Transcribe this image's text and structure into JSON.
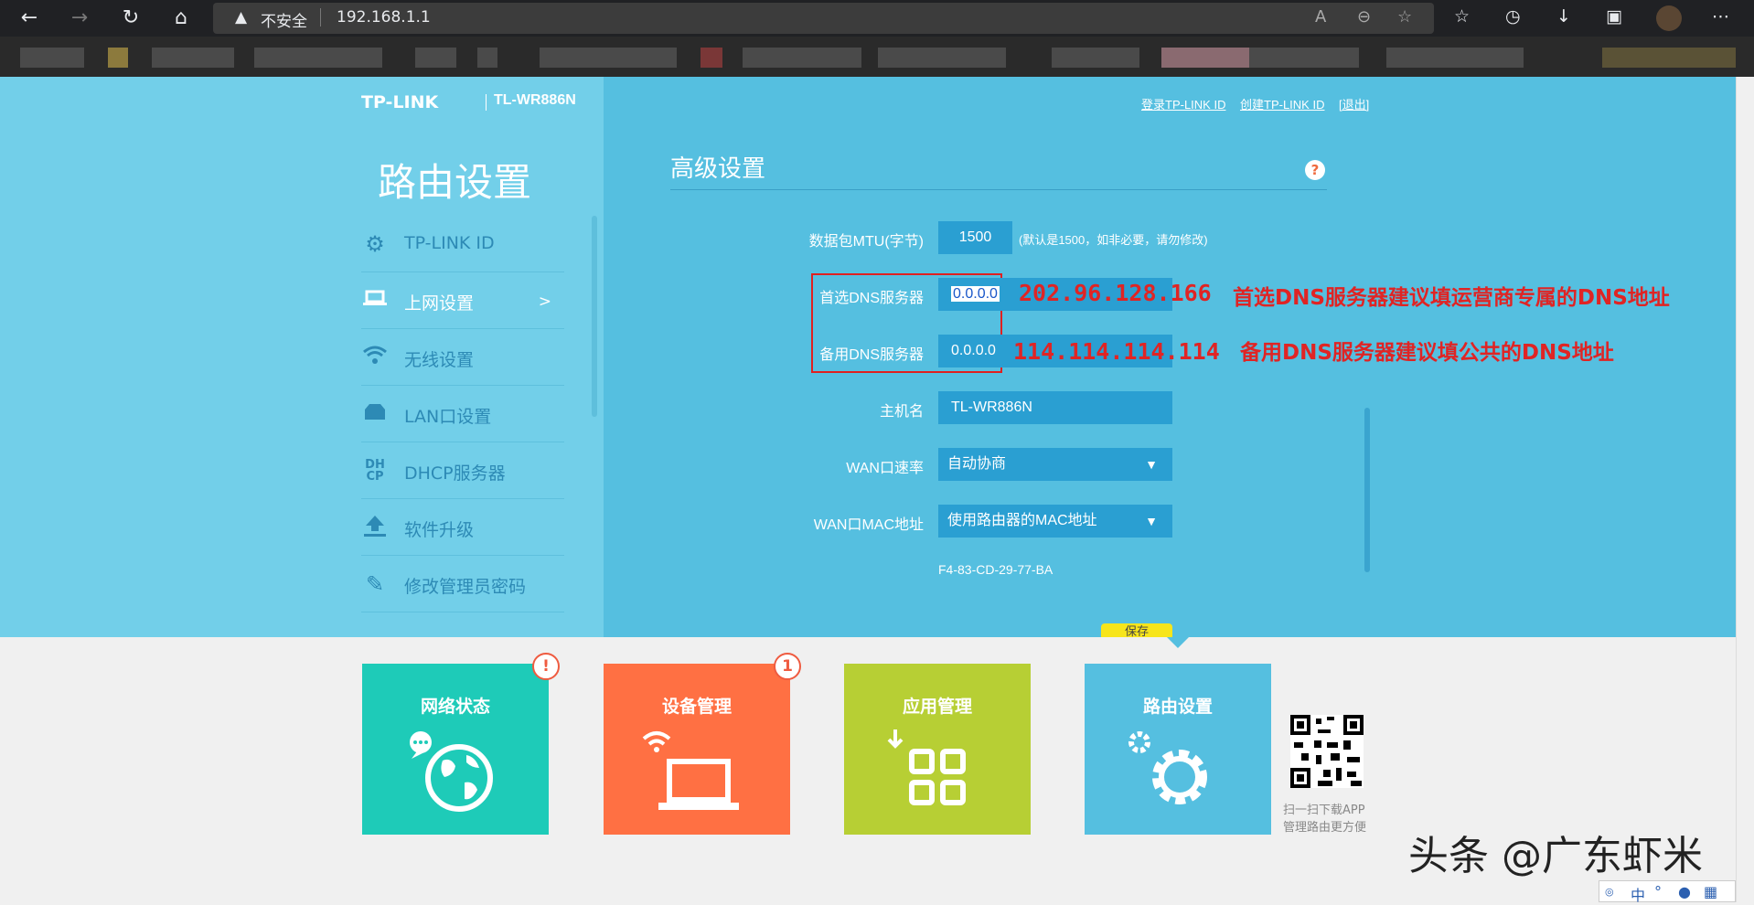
{
  "browser": {
    "insecure_label": "不安全",
    "url": "192.168.1.1"
  },
  "router": {
    "brand": "TP-LINK",
    "model": "TL-WR886N",
    "links": {
      "login": "登录TP-LINK ID",
      "create": "创建TP-LINK ID",
      "logout": "[退出]"
    },
    "sidebar": {
      "title": "路由设置",
      "items": [
        {
          "label": "TP-LINK ID",
          "icon": "gear-icon"
        },
        {
          "label": "上网设置",
          "icon": "laptop-icon",
          "arrow": ">"
        },
        {
          "label": "无线设置",
          "icon": "wifi-icon"
        },
        {
          "label": "LAN口设置",
          "icon": "lan-icon"
        },
        {
          "label": "DHCP服务器",
          "icon": "dhcp-icon"
        },
        {
          "label": "软件升级",
          "icon": "upload-icon"
        },
        {
          "label": "修改管理员密码",
          "icon": "pencil-icon"
        }
      ]
    },
    "section": {
      "title": "高级设置",
      "help": "?"
    },
    "form": {
      "mtu": {
        "label": "数据包MTU(字节)",
        "value": "1500",
        "hint": "(默认是1500，如非必要，请勿修改)"
      },
      "dns1": {
        "label": "首选DNS服务器",
        "value": "0.0.0.0"
      },
      "dns2": {
        "label": "备用DNS服务器",
        "value": "0.0.0.0"
      },
      "hostname": {
        "label": "主机名",
        "value": "TL-WR886N"
      },
      "wan_speed": {
        "label": "WAN口速率",
        "value": "自动协商"
      },
      "wan_mac": {
        "label": "WAN口MAC地址",
        "value": "使用路由器的MAC地址",
        "mac": "F4-83-CD-29-77-BA"
      },
      "save": "保存"
    },
    "annotations": {
      "dns1_ip": "202.96.128.166",
      "dns1_note": "首选DNS服务器建议填运营商专属的DNS地址",
      "dns2_ip": "114.114.114.114",
      "dns2_note": "备用DNS服务器建议填公共的DNS地址"
    },
    "tiles": [
      {
        "title": "网络状态",
        "color": "#1ecbb8",
        "badge": "!"
      },
      {
        "title": "设备管理",
        "color": "#ff7043",
        "badge": "1"
      },
      {
        "title": "应用管理",
        "color": "#b7cf34",
        "badge": ""
      },
      {
        "title": "路由设置",
        "color": "#55bfe0",
        "badge": ""
      }
    ],
    "qr_caption": [
      "扫一扫下载APP",
      "管理路由更方便"
    ]
  },
  "watermark": "头条 @广东虾米",
  "ime": {
    "lang": "中"
  }
}
